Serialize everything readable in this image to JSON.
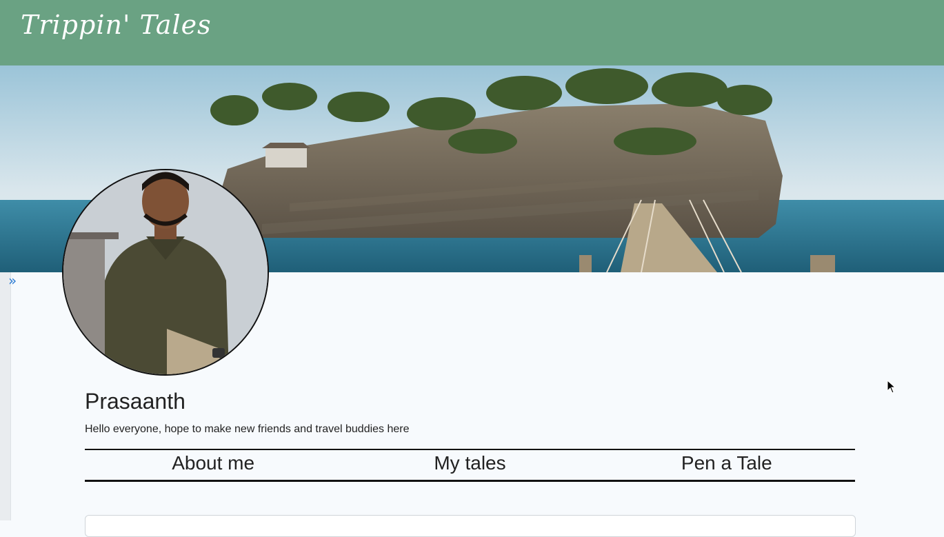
{
  "header": {
    "brand": "Trippin' Tales"
  },
  "hero": {
    "image_alt": "Island cliff with wooden rope bridge over the sea"
  },
  "sidebar": {
    "toggle_icon": "chevron-double-right-icon",
    "toggle_glyph": "»"
  },
  "profile": {
    "name": "Prasaanth",
    "bio": "Hello everyone, hope to make new friends and travel buddies here"
  },
  "tabs": [
    {
      "label": "About me"
    },
    {
      "label": "My tales"
    },
    {
      "label": "Pen a Tale"
    }
  ],
  "colors": {
    "header_bg": "#6aa283",
    "page_bg": "#f7fafd",
    "accent": "#2b7bd3"
  }
}
